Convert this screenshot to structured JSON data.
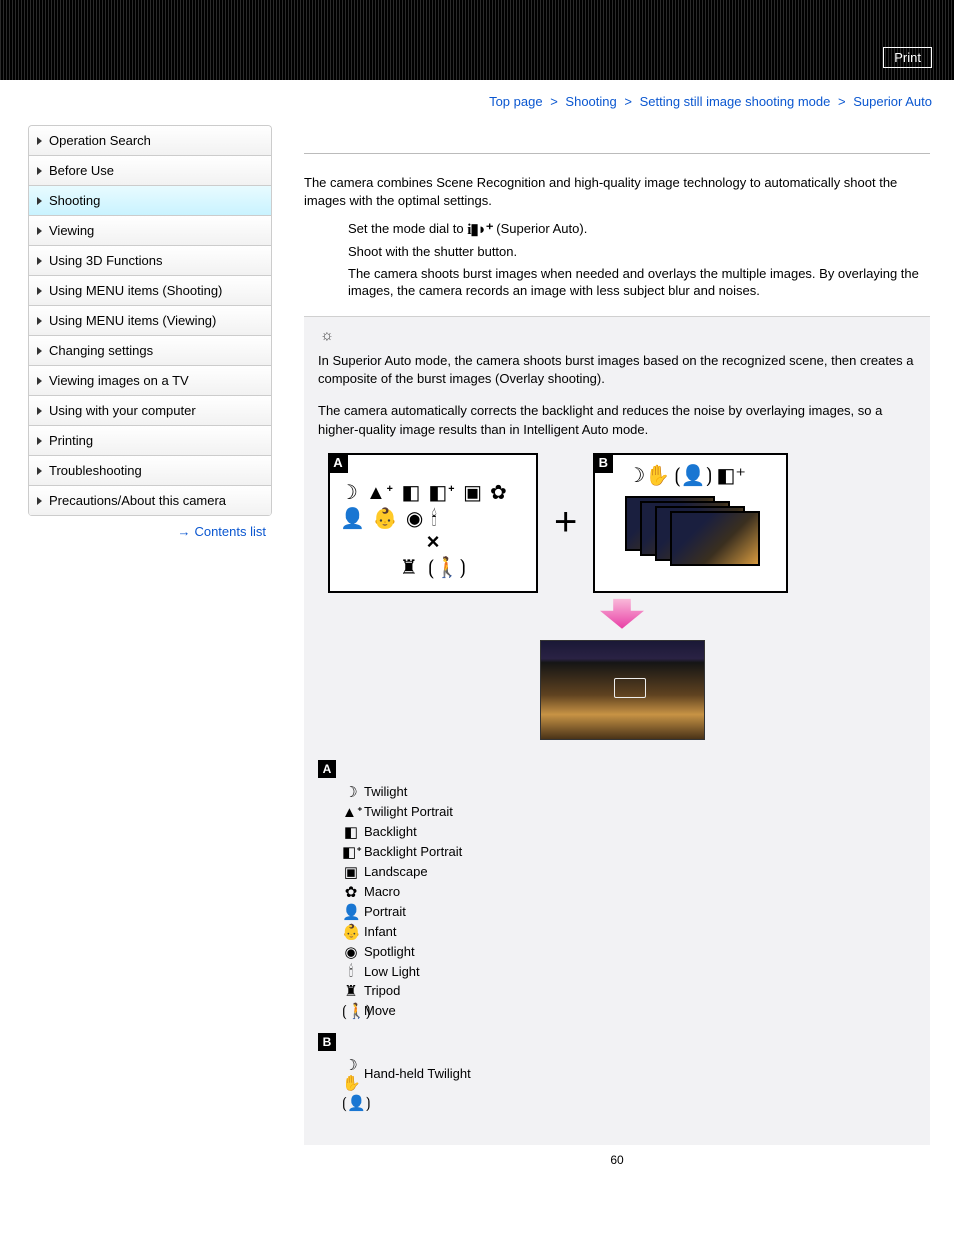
{
  "header": {
    "print_label": "Print"
  },
  "breadcrumb": {
    "items": [
      "Top page",
      "Shooting",
      "Setting still image shooting mode",
      "Superior Auto"
    ],
    "sep": ">"
  },
  "sidebar": {
    "items": [
      {
        "label": "Operation Search",
        "active": false
      },
      {
        "label": "Before Use",
        "active": false
      },
      {
        "label": "Shooting",
        "active": true
      },
      {
        "label": "Viewing",
        "active": false
      },
      {
        "label": "Using 3D Functions",
        "active": false
      },
      {
        "label": "Using MENU items (Shooting)",
        "active": false
      },
      {
        "label": "Using MENU items (Viewing)",
        "active": false
      },
      {
        "label": "Changing settings",
        "active": false
      },
      {
        "label": "Viewing images on a TV",
        "active": false
      },
      {
        "label": "Using with your computer",
        "active": false
      },
      {
        "label": "Printing",
        "active": false
      },
      {
        "label": "Troubleshooting",
        "active": false
      },
      {
        "label": "Precautions/About this camera",
        "active": false
      }
    ],
    "contents_link": "Contents list"
  },
  "main": {
    "intro": "The camera combines Scene Recognition and high-quality image technology to automatically shoot the images with the optimal settings.",
    "step1_prefix": "Set the mode dial to ",
    "step1_suffix": " (Superior Auto).",
    "step2a": "Shoot with the shutter button.",
    "step2b": "The camera shoots burst images when needed and overlays the multiple images. By overlaying the images, the camera records an image with less subject blur and noises.",
    "tip1": "In Superior Auto mode, the camera shoots burst images based on the recognized scene, then creates a composite of the burst images (Overlay shooting).",
    "tip2": "The camera automatically corrects the backlight and reduces the noise by overlaying images, so a higher-quality image results than in Intelligent Auto mode.",
    "legend_a_label": "A",
    "legend_b_label": "B",
    "legend_a": [
      {
        "icon": "☽",
        "text": "Twilight"
      },
      {
        "icon": "▲ᐩ",
        "text": "Twilight Portrait"
      },
      {
        "icon": "◧",
        "text": "Backlight"
      },
      {
        "icon": "◧ᐩ",
        "text": "Backlight Portrait"
      },
      {
        "icon": "▣",
        "text": "Landscape"
      },
      {
        "icon": "✿",
        "text": "Macro"
      },
      {
        "icon": "👤",
        "text": "Portrait"
      },
      {
        "icon": "👶",
        "text": "Infant"
      },
      {
        "icon": "◉",
        "text": "Spotlight"
      },
      {
        "icon": "🕯",
        "text": "Low Light"
      },
      {
        "icon": "♜",
        "text": "Tripod"
      },
      {
        "icon": "⟮🚶⟯",
        "text": "Move"
      }
    ],
    "legend_b": [
      {
        "icon": "☽✋",
        "text": "Hand-held Twilight"
      },
      {
        "icon": "⟮👤⟯",
        "text": ""
      }
    ],
    "page_number": "60"
  }
}
